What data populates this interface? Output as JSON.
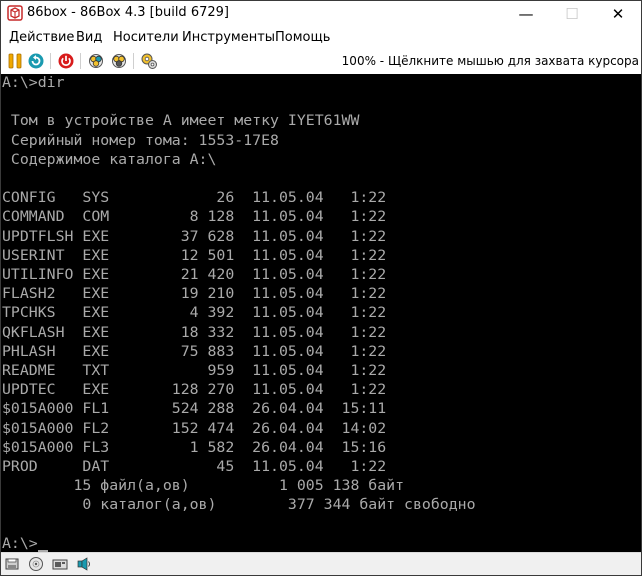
{
  "window": {
    "title": "86box - 86Box 4.3 [build 6729]",
    "minimize_glyph": "—",
    "maximize_glyph": "☐",
    "close_glyph": "✕"
  },
  "menu": {
    "items": [
      "Действие",
      "Вид",
      "Носители",
      "Инструменты",
      "Помощь"
    ]
  },
  "toolbar": {
    "icons": [
      "pause-icon",
      "reset-icon",
      "power-off-icon",
      "ctrl-alt-del-icon",
      "ctrl-alt-esc-icon",
      "settings-icon"
    ],
    "status_hint": "100% - Щёлкните мышью для захвата курсора"
  },
  "terminal": {
    "lines": [
      "A:\\>dir",
      "",
      " Том в устройстве A имеет метку IYET61WW",
      " Серийный номер тома: 1553-17E8",
      " Содержимое каталога A:\\",
      "",
      "CONFIG   SYS            26  11.05.04   1:22",
      "COMMAND  COM         8 128  11.05.04   1:22",
      "UPDTFLSH EXE        37 628  11.05.04   1:22",
      "USERINT  EXE        12 501  11.05.04   1:22",
      "UTILINFO EXE        21 420  11.05.04   1:22",
      "FLASH2   EXE        19 210  11.05.04   1:22",
      "TPCHKS   EXE         4 392  11.05.04   1:22",
      "QKFLASH  EXE        18 332  11.05.04   1:22",
      "PHLASH   EXE        75 883  11.05.04   1:22",
      "README   TXT           959  11.05.04   1:22",
      "UPDTEC   EXE       128 270  11.05.04   1:22",
      "$015A000 FL1       524 288  26.04.04  15:11",
      "$015A000 FL2       152 474  26.04.04  14:02",
      "$015A000 FL3         1 582  26.04.04  15:16",
      "PROD     DAT            45  11.05.04   1:22",
      "        15 файл(а,ов)          1 005 138 байт",
      "         0 каталог(а,ов)        377 344 байт свободно",
      "",
      "A:\\>"
    ]
  },
  "statusbar": {
    "icons": [
      "floppy-drive-icon",
      "cdrom-drive-icon",
      "network-icon",
      "sound-icon"
    ]
  },
  "colors": {
    "terminal_bg": "#000000",
    "terminal_fg": "#aaaaaa",
    "pause_accent": "#f0a800",
    "power_red": "#d81b1b",
    "reset_teal": "#1a9ab0"
  }
}
